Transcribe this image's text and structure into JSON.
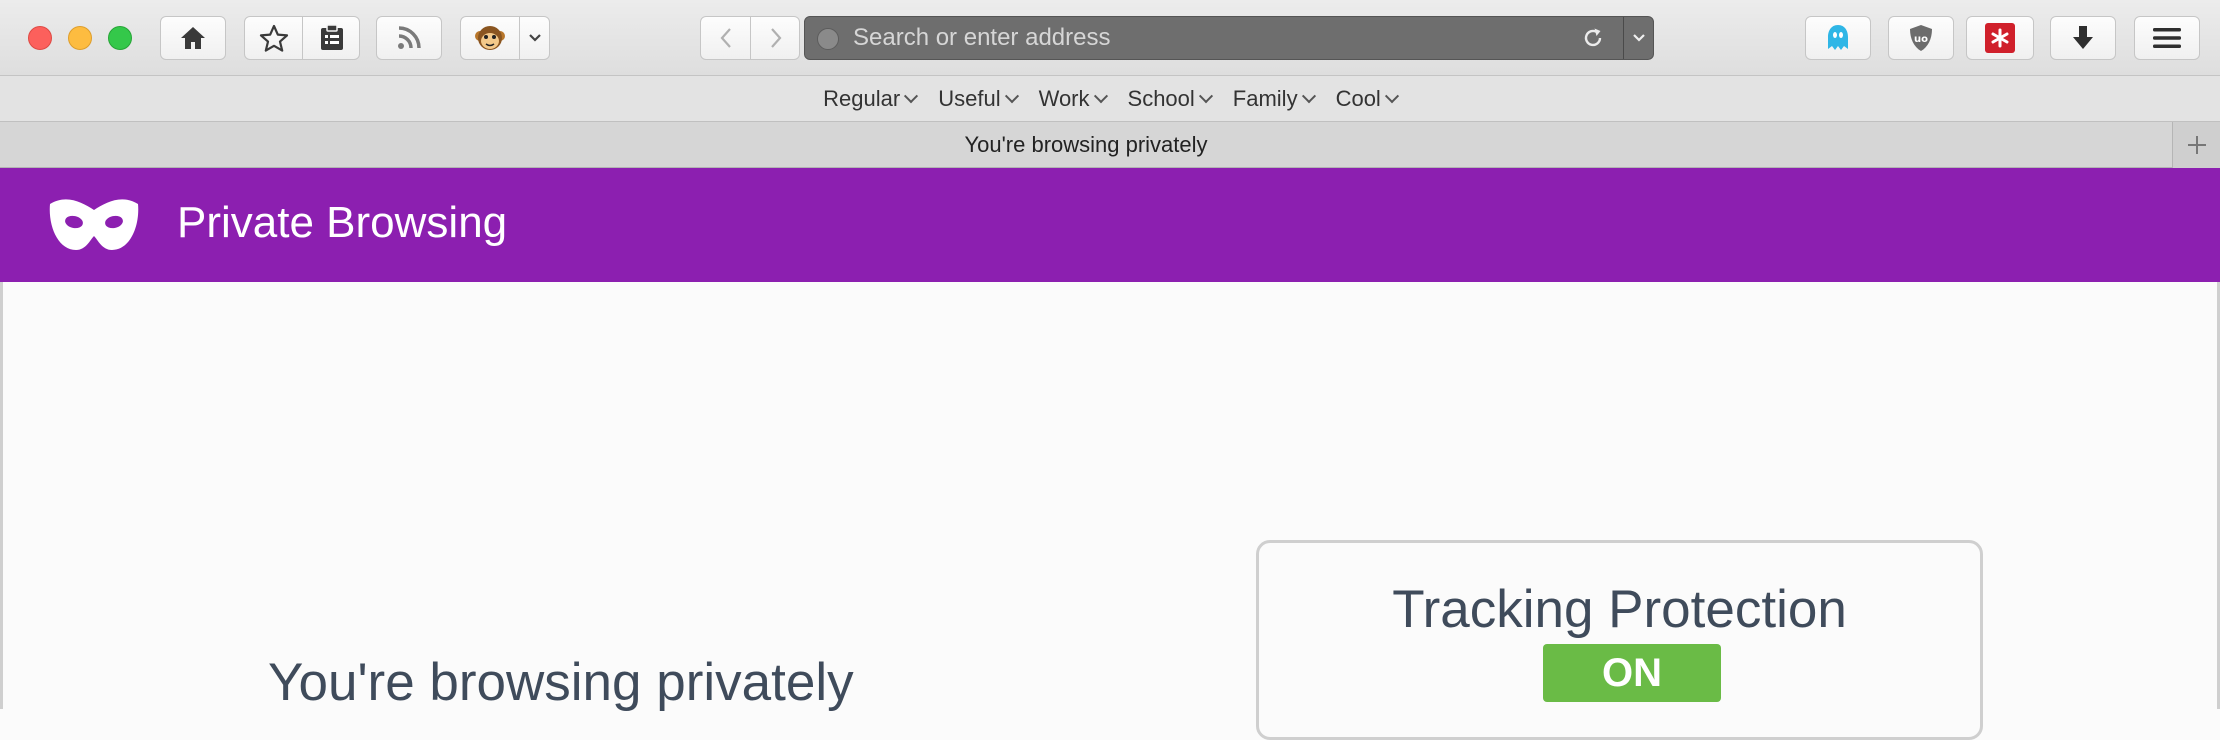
{
  "toolbar": {
    "url_placeholder": "Search or enter address"
  },
  "bookmarks": [
    {
      "label": "Regular"
    },
    {
      "label": "Useful"
    },
    {
      "label": "Work"
    },
    {
      "label": "School"
    },
    {
      "label": "Family"
    },
    {
      "label": "Cool"
    }
  ],
  "tab": {
    "title": "You're browsing privately"
  },
  "header": {
    "title": "Private Browsing",
    "color": "#8c1fb0"
  },
  "main": {
    "heading": "You're browsing privately"
  },
  "tracking_protection": {
    "title": "Tracking Protection",
    "status": "ON",
    "status_color": "#6abb46"
  }
}
